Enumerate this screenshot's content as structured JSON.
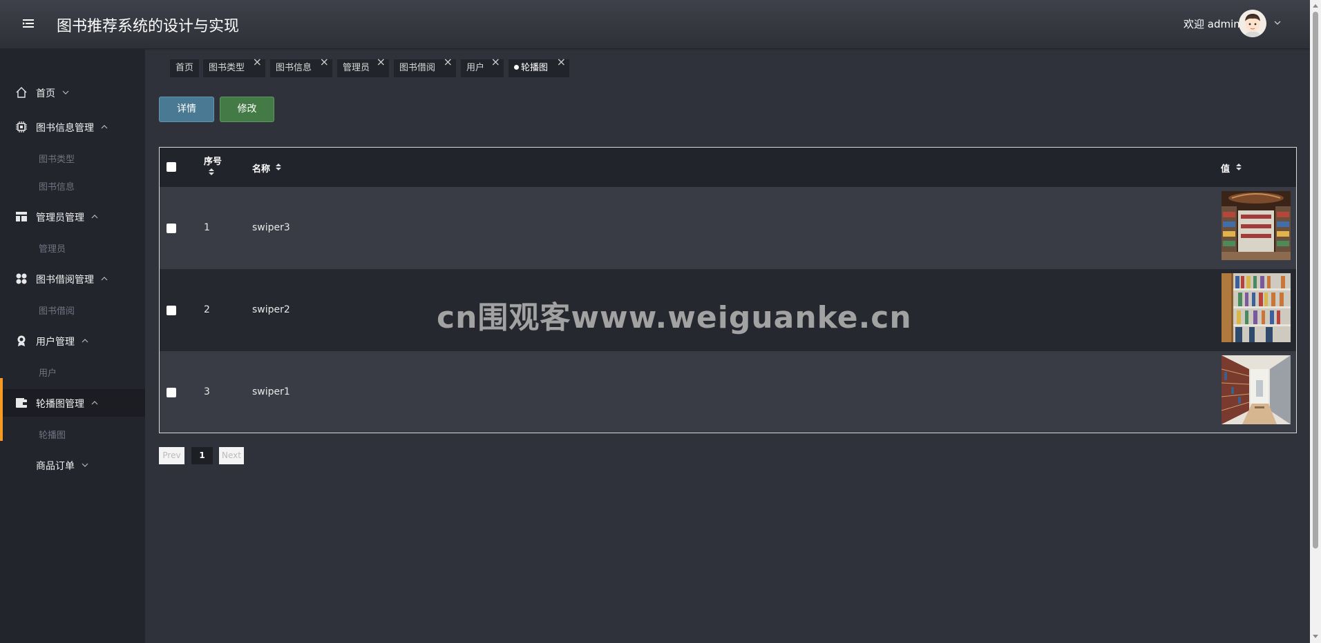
{
  "header": {
    "app_title": "图书推荐系统的设计与实现",
    "welcome": "欢迎 admin",
    "icons": {
      "menu_toggle": "hamburger-icon",
      "avatar": "cartoon-avatar",
      "user_menu": "chevron-down-icon"
    }
  },
  "sidebar": {
    "menus": [
      {
        "label": "首页",
        "icon": "home-icon",
        "expanded": false,
        "items": []
      },
      {
        "label": "图书信息管理",
        "icon": "chip-icon",
        "expanded": true,
        "items": [
          "图书类型",
          "图书信息"
        ]
      },
      {
        "label": "管理员管理",
        "icon": "layout-icon",
        "expanded": true,
        "items": [
          "管理员"
        ]
      },
      {
        "label": "图书借阅管理",
        "icon": "grid-dots-icon",
        "expanded": true,
        "items": [
          "图书借阅"
        ]
      },
      {
        "label": "用户管理",
        "icon": "user-badge-icon",
        "expanded": true,
        "items": [
          "用户"
        ]
      },
      {
        "label": "轮播图管理",
        "icon": "wallet-icon",
        "expanded": true,
        "active": true,
        "items": [
          "轮播图"
        ]
      },
      {
        "label": "商品订单",
        "icon": "",
        "expanded": false,
        "items": []
      }
    ]
  },
  "tabs": [
    {
      "label": "首页",
      "closable": false
    },
    {
      "label": "图书类型",
      "closable": true
    },
    {
      "label": "图书信息",
      "closable": true
    },
    {
      "label": "管理员",
      "closable": true
    },
    {
      "label": "图书借阅",
      "closable": true
    },
    {
      "label": "用户",
      "closable": true
    },
    {
      "label": "轮播图",
      "closable": true,
      "current": true
    }
  ],
  "tab_close_glyph": "×",
  "toolbar": {
    "detail_label": "详情",
    "edit_label": "修改"
  },
  "table": {
    "columns": [
      "序号",
      "名称",
      "值"
    ],
    "rows": [
      {
        "index": "1",
        "name": "swiper3",
        "image": "bookstore-shelves-photo"
      },
      {
        "index": "2",
        "name": "swiper2",
        "image": "bookshelf-closeup-photo"
      },
      {
        "index": "3",
        "name": "swiper1",
        "image": "library-aisle-photo"
      }
    ]
  },
  "pagination": {
    "prev": "Prev",
    "current": "1",
    "next": "Next"
  },
  "watermark": "cn围观客www.weiguanke.cn",
  "colors": {
    "accent": "#f59a23",
    "detail_button": "#4a7a93",
    "edit_button": "#447a46",
    "background": "#30323b",
    "sidebar": "#23252d"
  }
}
